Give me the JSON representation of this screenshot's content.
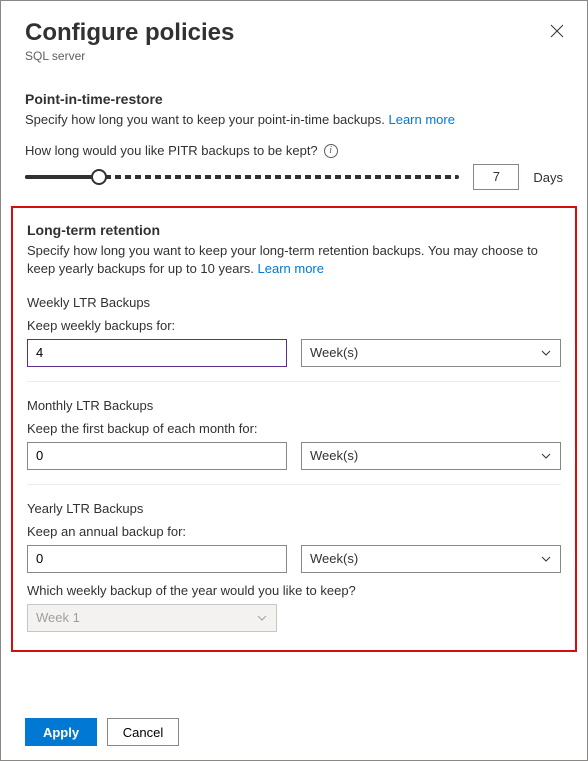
{
  "header": {
    "title": "Configure policies",
    "subtitle": "SQL server"
  },
  "pitr": {
    "title": "Point-in-time-restore",
    "desc": "Specify how long you want to keep your point-in-time backups. ",
    "learn_more": "Learn more",
    "slider_label": "How long would you like PITR backups to be kept?",
    "value": "7",
    "unit": "Days",
    "slider_percent": 17
  },
  "ltr": {
    "title": "Long-term retention",
    "desc": "Specify how long you want to keep your long-term retention backups. You may choose to keep yearly backups for up to 10 years. ",
    "learn_more": "Learn more",
    "weekly": {
      "heading": "Weekly LTR Backups",
      "label": "Keep weekly backups for:",
      "value": "4",
      "unit": "Week(s)"
    },
    "monthly": {
      "heading": "Monthly LTR Backups",
      "label": "Keep the first backup of each month for:",
      "value": "0",
      "unit": "Week(s)"
    },
    "yearly": {
      "heading": "Yearly LTR Backups",
      "label": "Keep an annual backup for:",
      "value": "0",
      "unit": "Week(s)",
      "which_label": "Which weekly backup of the year would you like to keep?",
      "which_value": "Week 1"
    }
  },
  "footer": {
    "apply": "Apply",
    "cancel": "Cancel"
  }
}
